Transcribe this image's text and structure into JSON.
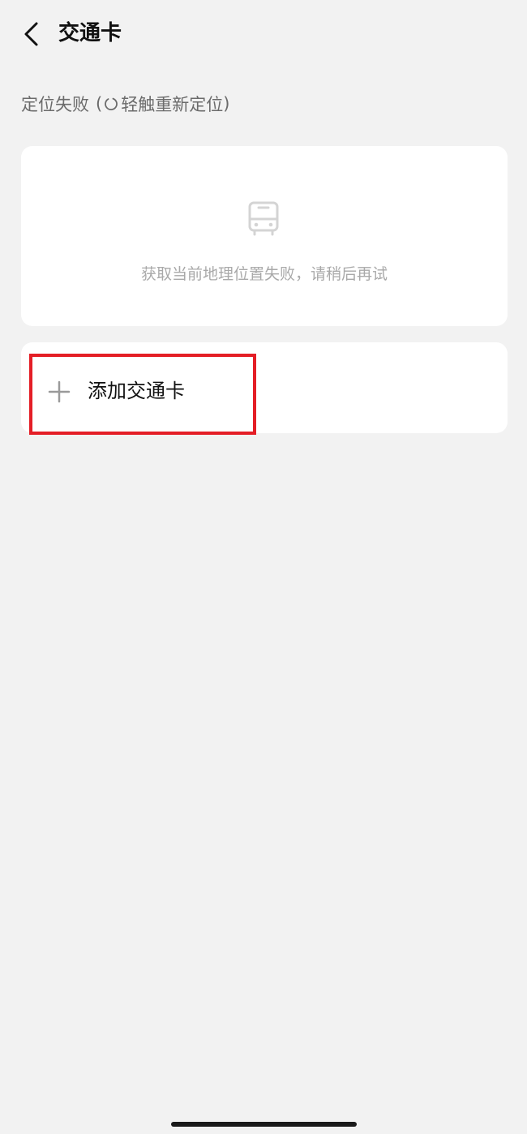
{
  "header": {
    "title": "交通卡",
    "back_icon": "chevron-left-icon"
  },
  "location": {
    "status": "定位失败",
    "paren_open": "(",
    "retry_icon": "refresh-icon",
    "retry_label": "轻触重新定位",
    "paren_close": ")"
  },
  "status_card": {
    "icon": "bus-icon",
    "message": "获取当前地理位置失败，请稍后再试"
  },
  "add_card": {
    "icon": "plus-icon",
    "label": "添加交通卡",
    "highlight_color": "#e41e26"
  },
  "colors": {
    "background": "#f2f2f2",
    "card": "#ffffff",
    "muted_text": "#a9a9a9"
  }
}
